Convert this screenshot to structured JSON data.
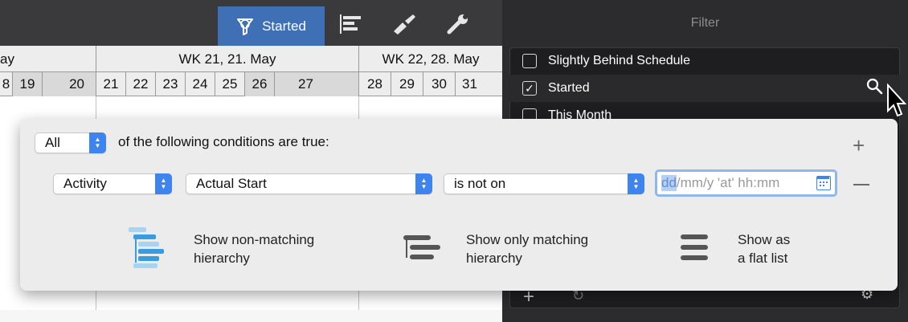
{
  "toolbar": {
    "active_filter_label": "Started",
    "colors": {
      "active_bg": "#3f6fb5",
      "toolbar_bg": "#3a3a3c"
    },
    "icons": [
      "filter-icon",
      "gantt-view-icon",
      "brush-icon",
      "wrench-icon"
    ]
  },
  "gantt": {
    "weeks": [
      {
        "label": "ay"
      },
      {
        "label": "WK 21, 21. May"
      },
      {
        "label": "WK 22, 28. May"
      }
    ],
    "days": [
      "8",
      "19",
      "20",
      "21",
      "22",
      "23",
      "24",
      "25",
      "26",
      "27",
      "28",
      "29",
      "30",
      "31"
    ]
  },
  "filter_panel": {
    "title": "Filter",
    "items": [
      {
        "label": "Slightly Behind Schedule",
        "checked": false
      },
      {
        "label": "Started",
        "checked": true
      },
      {
        "label": "This Month",
        "checked": false
      }
    ],
    "bottom_add": "+",
    "bottom_refresh": "↻",
    "bottom_gear": "⚙"
  },
  "condition_editor": {
    "match_mode": "All",
    "condition_text": "of the following conditions are true:",
    "rule": {
      "scope": "Activity",
      "field": "Actual Start",
      "operator": "is not on",
      "date_placeholder_highlight": "dd",
      "date_placeholder_rest": "/mm/y 'at' hh:mm"
    },
    "add_label": "+",
    "show_options": [
      {
        "line1": "Show non-matching",
        "line2": "hierarchy"
      },
      {
        "line1": "Show only matching",
        "line2": "hierarchy"
      },
      {
        "line1": "Show as",
        "line2": "a flat list"
      }
    ],
    "colors": {
      "accent": "#3d84ee",
      "icon_blue": "#3a9ce0",
      "icon_gray": "#555555"
    }
  }
}
